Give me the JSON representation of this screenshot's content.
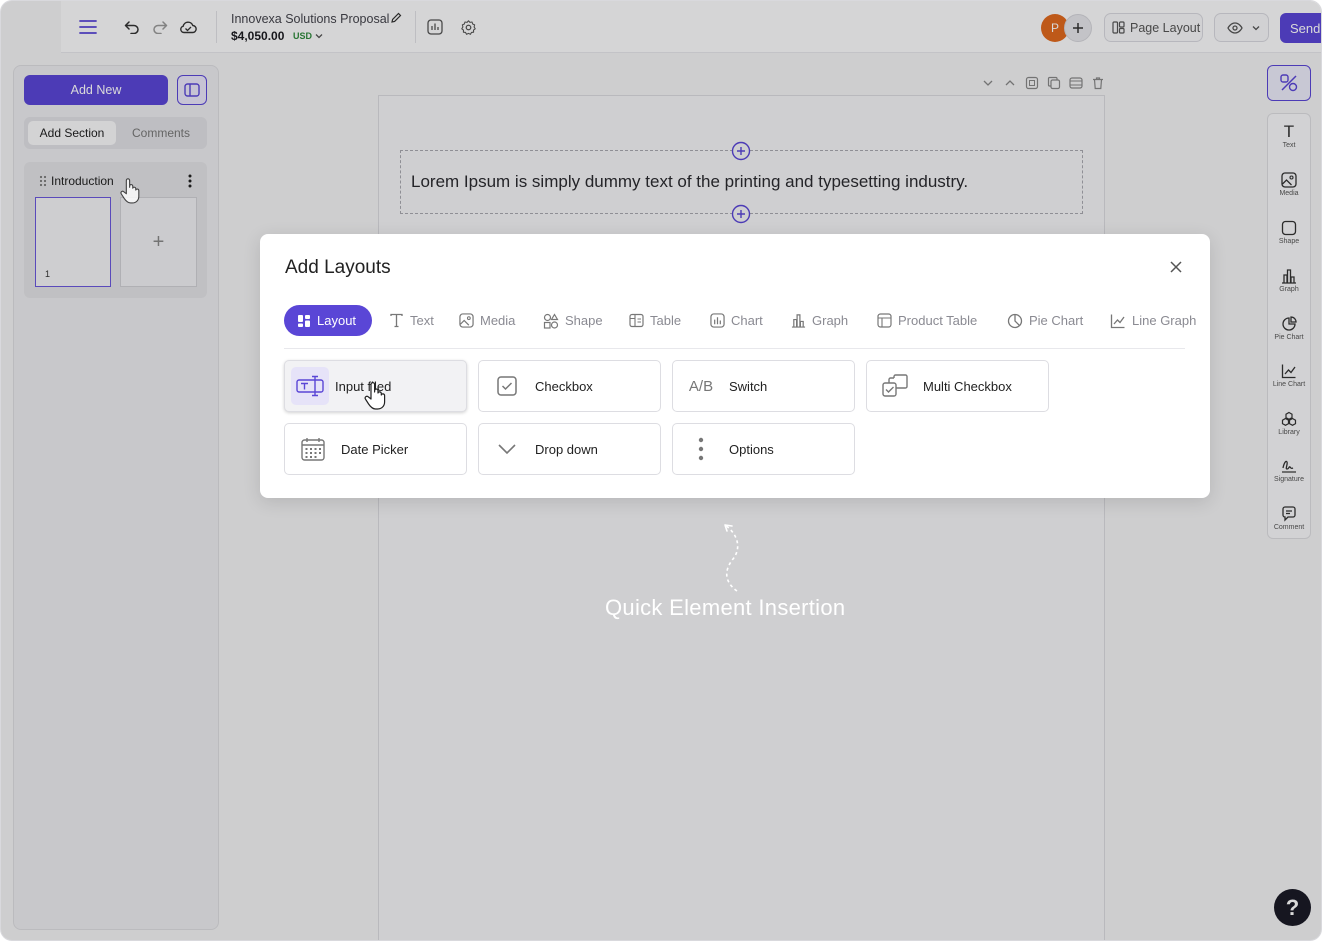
{
  "topbar": {
    "doc_title": "Innovexa Solutions Proposal",
    "doc_amount": "$4,050.00",
    "currency": "USD",
    "avatar_initial": "P",
    "page_layout_label": "Page Layout",
    "send_label": "Send"
  },
  "left_panel": {
    "add_new_label": "Add New",
    "tabs": [
      "Add Section",
      "Comments"
    ],
    "section_name": "Introduction",
    "page_number": "1",
    "add_page_symbol": "+"
  },
  "canvas": {
    "text": "Lorem Ipsum is simply dummy text of the printing and typesetting industry.",
    "annotation": "Quick Element Insertion"
  },
  "right_toolbar": {
    "items": [
      "Text",
      "Media",
      "Shape",
      "Graph",
      "Pie Chart",
      "Line Chart",
      "Library",
      "Signature",
      "Comment"
    ],
    "text_icon_glyph": "T"
  },
  "modal": {
    "title": "Add Layouts",
    "tabs": [
      "Layout",
      "Text",
      "Media",
      "Shape",
      "Table",
      "Chart",
      "Graph",
      "Product Table",
      "Pie Chart",
      "Line Graph"
    ],
    "active_tab": "Layout",
    "elements": [
      "Input filed",
      "Checkbox",
      "Switch",
      "Multi Checkbox",
      "Date Picker",
      "Drop down",
      "Options"
    ],
    "switch_glyph": "A/B"
  },
  "help_label": "?",
  "colors": {
    "accent": "#5a46d6",
    "currency_green": "#2f8a3d",
    "avatar_orange": "#e0691e",
    "help_dark": "#1a1a26"
  }
}
